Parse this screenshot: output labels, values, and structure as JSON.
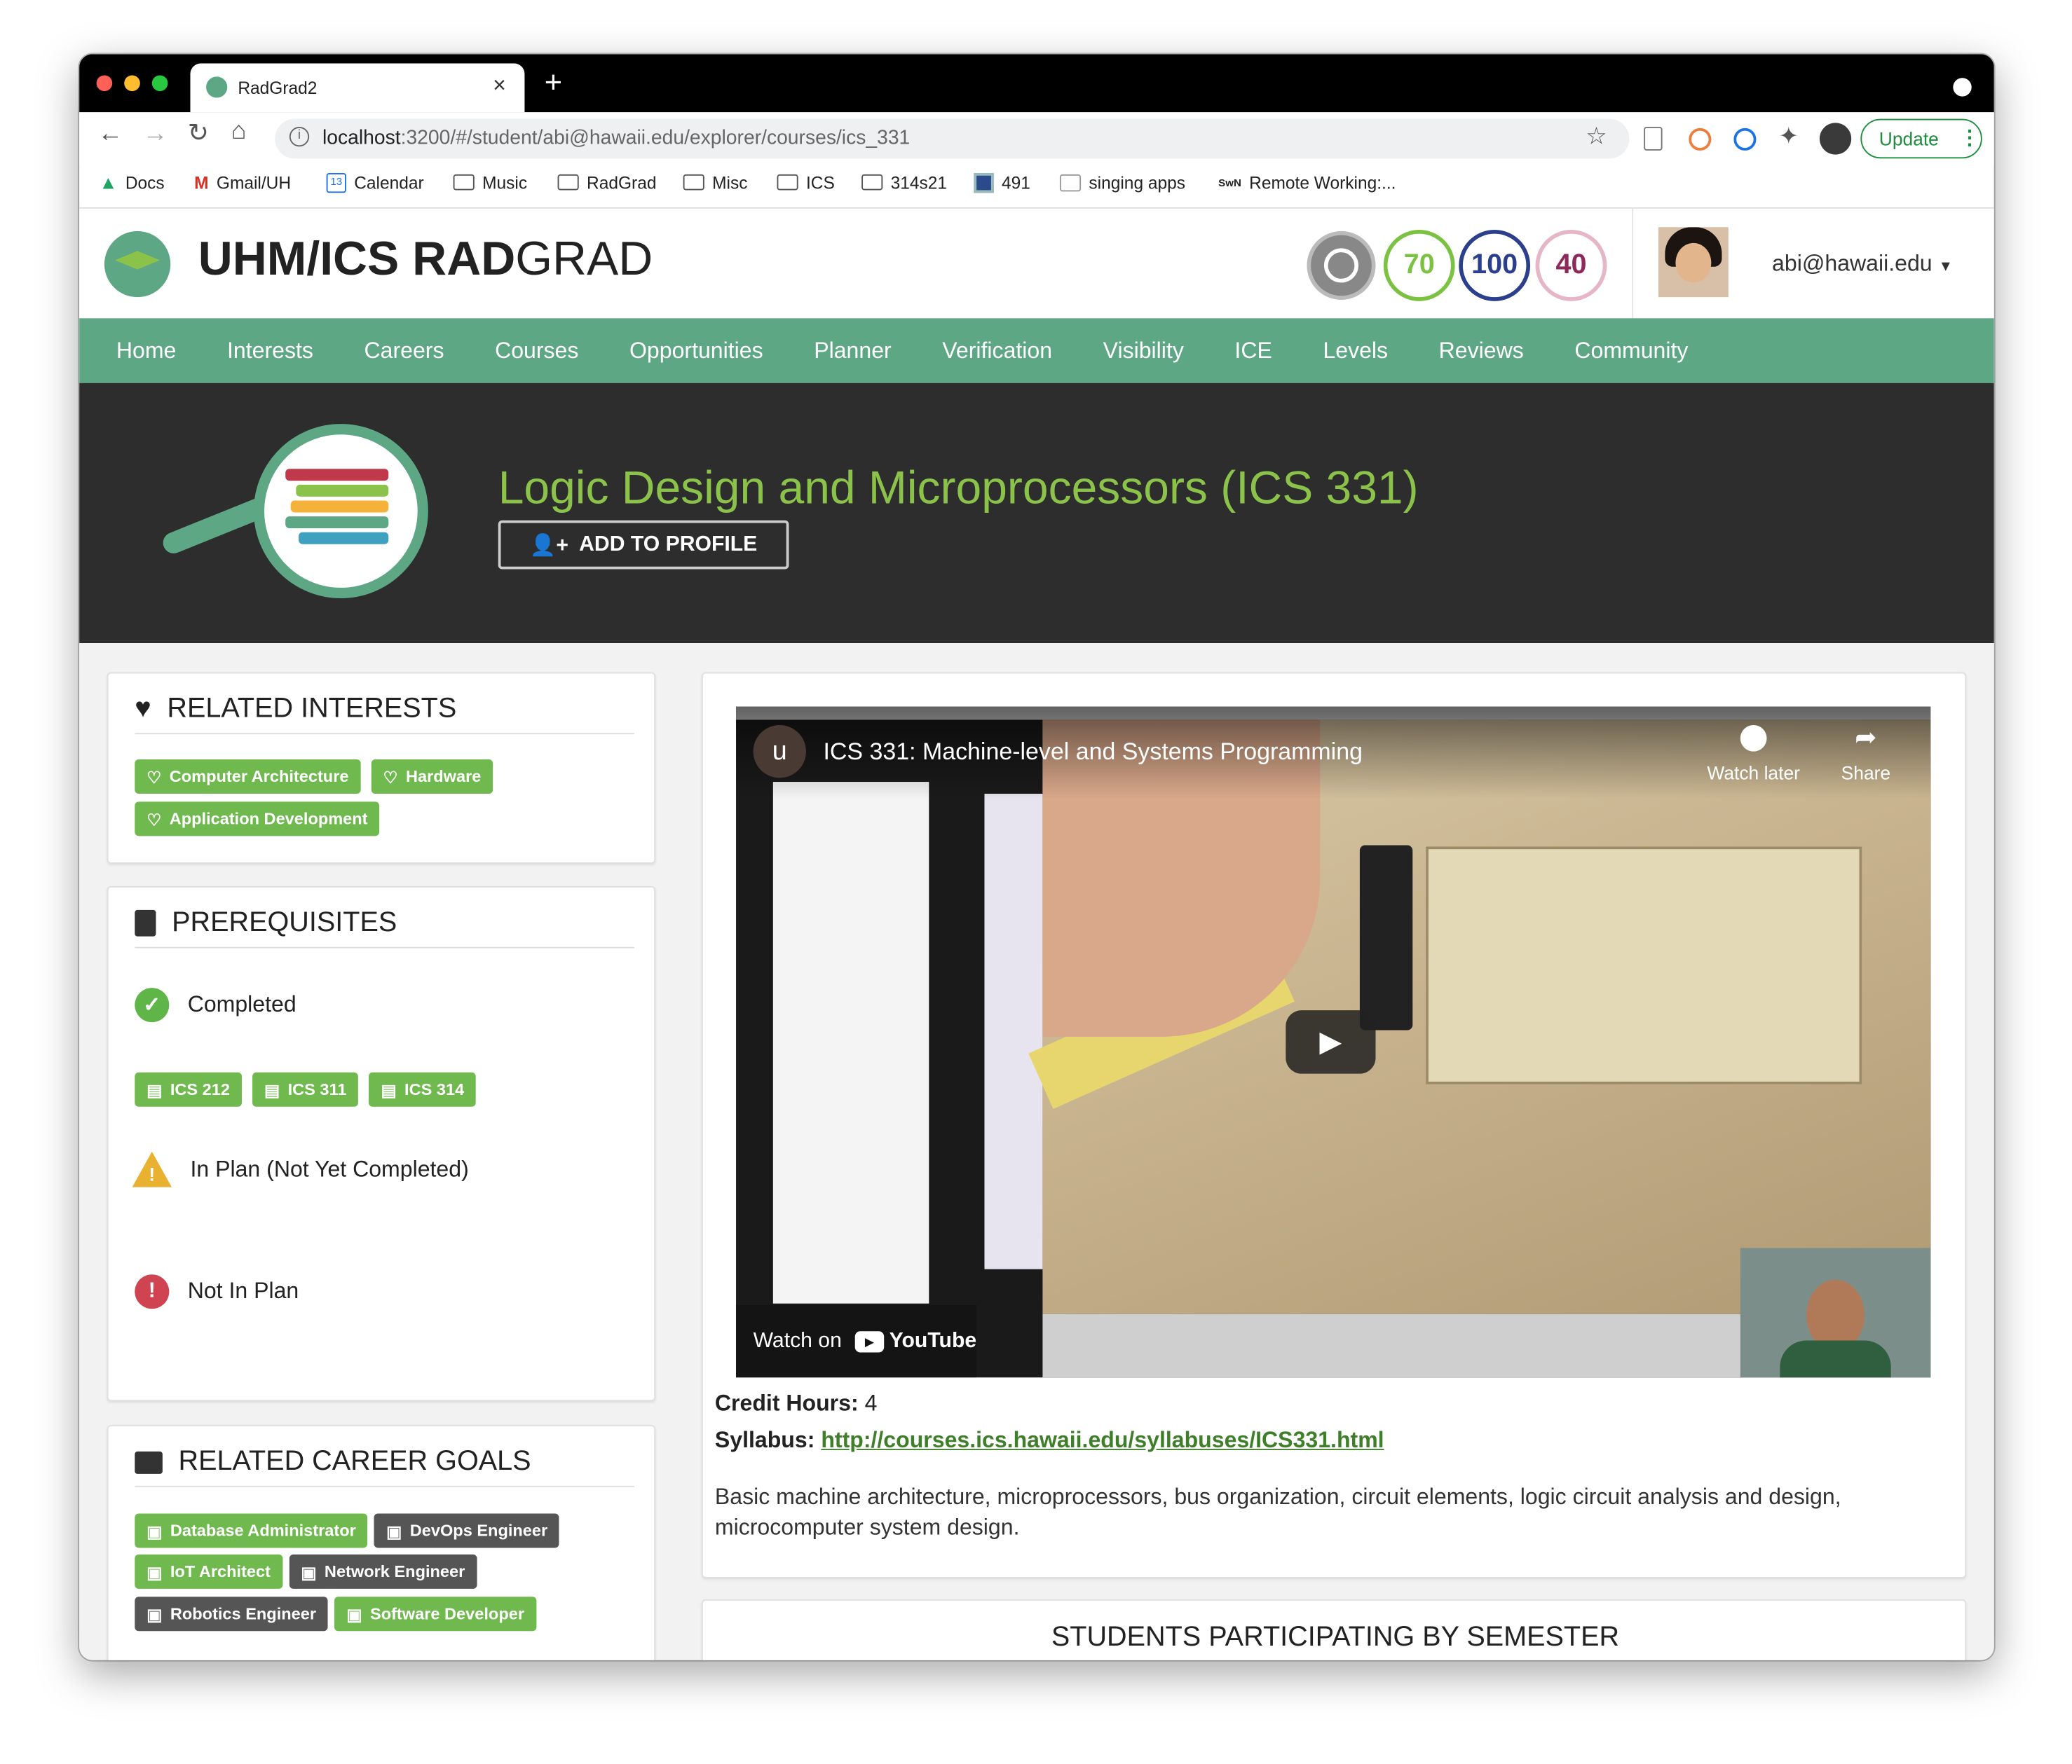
{
  "browser": {
    "tab_title": "RadGrad2",
    "url_host": "localhost",
    "url_rest": ":3200/#/student/abi@hawaii.edu/explorer/courses/ics_331",
    "update_label": "Update"
  },
  "bookmarks": [
    "Docs",
    "Gmail/UH",
    "Calendar",
    "Music",
    "RadGrad",
    "Misc",
    "ICS",
    "314s21",
    "491",
    "singing apps",
    "Remote Working:..."
  ],
  "header": {
    "brand_bold": "UHM/ICS RAD",
    "brand_light": "GRAD",
    "levels": [
      {
        "value": "70",
        "color": "#7cc242"
      },
      {
        "value": "100",
        "color": "#2b3f8c"
      },
      {
        "value": "40",
        "color": "#8c2a59"
      }
    ],
    "username": "abi@hawaii.edu"
  },
  "nav": [
    "Home",
    "Interests",
    "Careers",
    "Courses",
    "Opportunities",
    "Planner",
    "Verification",
    "Visibility",
    "ICE",
    "Levels",
    "Reviews",
    "Community"
  ],
  "course": {
    "title": "Logic Design and Microprocessors (ICS 331)",
    "add_button": "ADD TO PROFILE",
    "credit_label": "Credit Hours:",
    "credit_value": "4",
    "syllabus_label": "Syllabus:",
    "syllabus_url": "http://courses.ics.hawaii.edu/syllabuses/ICS331.html",
    "description": "Basic machine architecture, microprocessors, bus organization, circuit elements, logic circuit analysis and design, microcomputer system design."
  },
  "video": {
    "channel_initial": "u",
    "title": "ICS 331: Machine-level and Systems Programming",
    "watch_later": "Watch later",
    "share": "Share",
    "watch_on": "Watch on",
    "youtube": "YouTube"
  },
  "interests": {
    "title": "RELATED INTERESTS",
    "items": [
      "Computer Architecture",
      "Hardware",
      "Application Development"
    ]
  },
  "prereqs": {
    "title": "PREREQUISITES",
    "completed": "Completed",
    "courses": [
      "ICS 212",
      "ICS 311",
      "ICS 314"
    ],
    "in_plan": "In Plan (Not Yet Completed)",
    "not_in_plan": "Not In Plan"
  },
  "careers": {
    "title": "RELATED CAREER GOALS",
    "items": [
      "Database Administrator",
      "DevOps Engineer",
      "IoT Architect",
      "Network Engineer",
      "Robotics Engineer",
      "Software Developer"
    ]
  },
  "students": {
    "title": "STUDENTS PARTICIPATING BY SEMESTER"
  },
  "colors": {
    "nav": "#5ea785",
    "title": "#8bc34a",
    "label_green": "#6fb94e",
    "label_grey": "#555555"
  }
}
